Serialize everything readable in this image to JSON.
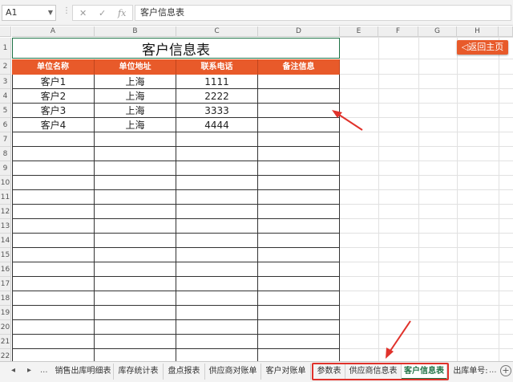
{
  "formula_bar": {
    "name_box": "A1",
    "cancel_symbol": "✕",
    "enter_symbol": "✓",
    "fx_label": "fx",
    "content": "客户信息表"
  },
  "columns": [
    "A",
    "B",
    "C",
    "D",
    "E",
    "F",
    "G",
    "H"
  ],
  "rows": [
    "1",
    "2",
    "3",
    "4",
    "5",
    "6",
    "7",
    "8",
    "9",
    "10",
    "11",
    "12",
    "13",
    "14",
    "15",
    "16",
    "17",
    "18",
    "19",
    "20",
    "21",
    "22"
  ],
  "sheet": {
    "title": "客户信息表",
    "headers": [
      "单位名称",
      "单位地址",
      "联系电话",
      "备注信息"
    ],
    "records": [
      [
        "客户1",
        "上海",
        "1111",
        ""
      ],
      [
        "客户2",
        "上海",
        "2222",
        ""
      ],
      [
        "客户3",
        "上海",
        "3333",
        ""
      ],
      [
        "客户4",
        "上海",
        "4444",
        ""
      ]
    ]
  },
  "back_button": "◁返回主页",
  "tabs": {
    "nav_prev": "◂",
    "nav_next": "▸",
    "ellipsis_left": "...",
    "names": [
      "销售出库明细表",
      "库存统计表",
      "盘点报表",
      "供应商对账单",
      "客户对账单",
      "参数表",
      "供应商信息表",
      "客户信息表",
      "出库单号:"
    ],
    "active": "客户信息表",
    "ellipsis_right": "...",
    "add_symbol": "+"
  },
  "colors": {
    "header_orange": "#e85a2a",
    "excel_green": "#217346",
    "annotation_red": "#e0322b"
  }
}
